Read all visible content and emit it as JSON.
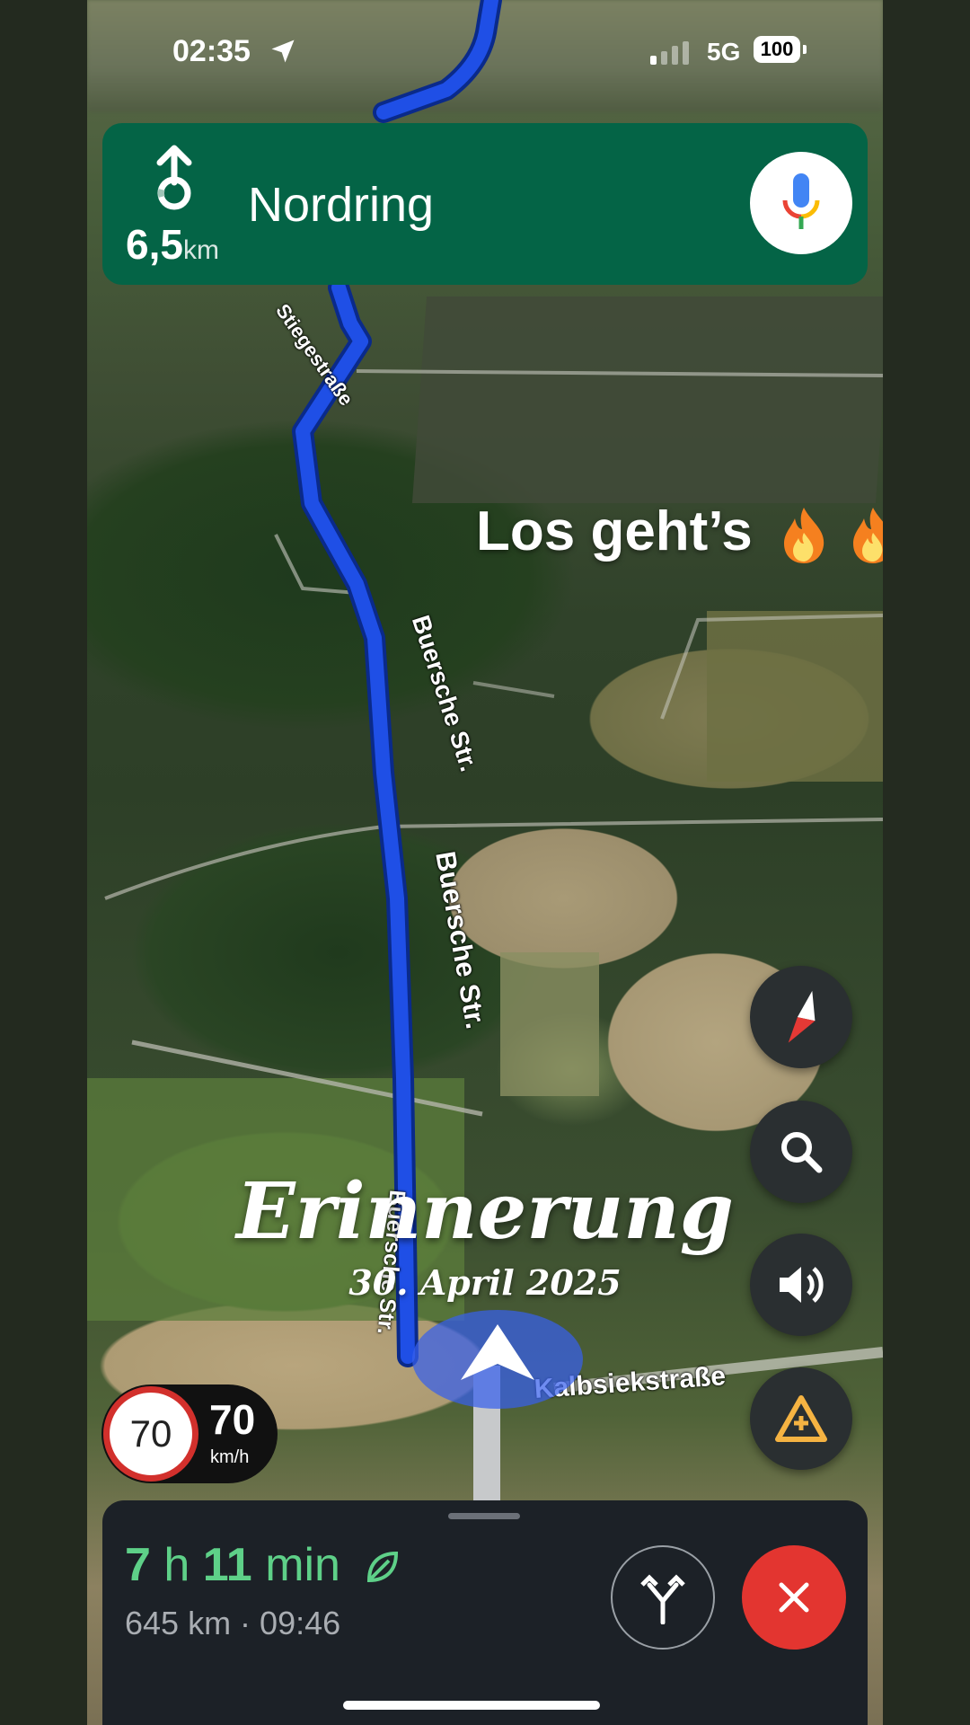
{
  "status_bar": {
    "time": "02:35",
    "network": "5G",
    "battery": "100"
  },
  "nav_banner": {
    "distance_value": "6,5",
    "distance_unit": "km",
    "street": "Nordring",
    "mic_icon": "google-mic-icon",
    "background_color": "#046446"
  },
  "map": {
    "roads": [
      "Buersche Str.",
      "Buersche Str.",
      "Buersche Str.",
      "Kalbsiekstraße",
      "Stiegestraße"
    ],
    "route_color": "#1f4fe6"
  },
  "overlay": {
    "caption": "Los geht’s",
    "memory_title": "Erinnerung",
    "memory_date": "30. April 2025"
  },
  "speed": {
    "limit": "70",
    "current": "70",
    "unit": "km/h"
  },
  "map_controls": [
    "compass-icon",
    "search-icon",
    "volume-icon",
    "report-incident-icon"
  ],
  "trip": {
    "hours": "7",
    "hours_unit": "h",
    "minutes": "11",
    "minutes_unit": "min",
    "meta": "645 km · 09:46",
    "eta_color": "#5ed088"
  },
  "actions": {
    "alt_routes_icon": "alternate-routes-icon",
    "close_icon": "close-icon",
    "close_color": "#e33530"
  }
}
